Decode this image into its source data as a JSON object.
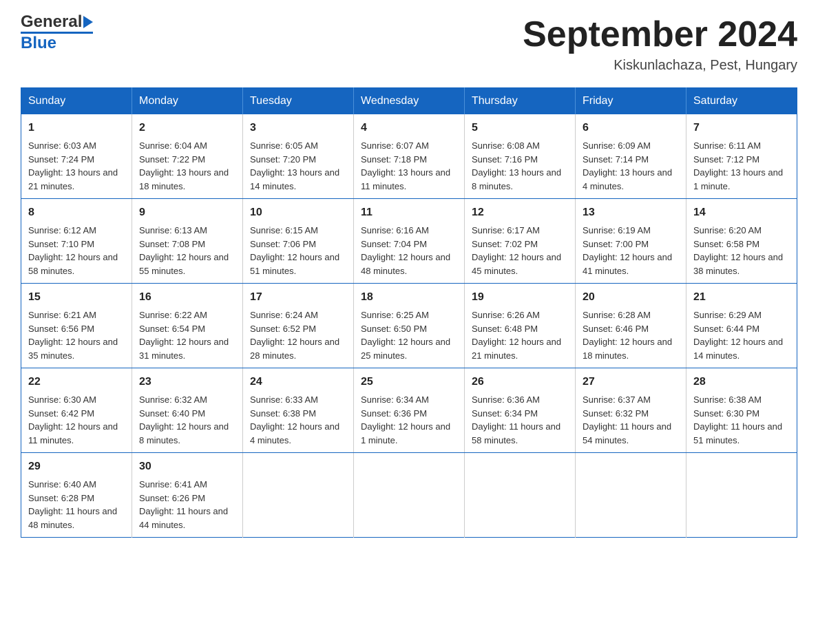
{
  "header": {
    "logo": {
      "line1": "General",
      "line2": "Blue"
    },
    "title": "September 2024",
    "location": "Kiskunlachaza, Pest, Hungary"
  },
  "weekdays": [
    "Sunday",
    "Monday",
    "Tuesday",
    "Wednesday",
    "Thursday",
    "Friday",
    "Saturday"
  ],
  "weeks": [
    [
      {
        "day": "1",
        "sunrise": "Sunrise: 6:03 AM",
        "sunset": "Sunset: 7:24 PM",
        "daylight": "Daylight: 13 hours and 21 minutes."
      },
      {
        "day": "2",
        "sunrise": "Sunrise: 6:04 AM",
        "sunset": "Sunset: 7:22 PM",
        "daylight": "Daylight: 13 hours and 18 minutes."
      },
      {
        "day": "3",
        "sunrise": "Sunrise: 6:05 AM",
        "sunset": "Sunset: 7:20 PM",
        "daylight": "Daylight: 13 hours and 14 minutes."
      },
      {
        "day": "4",
        "sunrise": "Sunrise: 6:07 AM",
        "sunset": "Sunset: 7:18 PM",
        "daylight": "Daylight: 13 hours and 11 minutes."
      },
      {
        "day": "5",
        "sunrise": "Sunrise: 6:08 AM",
        "sunset": "Sunset: 7:16 PM",
        "daylight": "Daylight: 13 hours and 8 minutes."
      },
      {
        "day": "6",
        "sunrise": "Sunrise: 6:09 AM",
        "sunset": "Sunset: 7:14 PM",
        "daylight": "Daylight: 13 hours and 4 minutes."
      },
      {
        "day": "7",
        "sunrise": "Sunrise: 6:11 AM",
        "sunset": "Sunset: 7:12 PM",
        "daylight": "Daylight: 13 hours and 1 minute."
      }
    ],
    [
      {
        "day": "8",
        "sunrise": "Sunrise: 6:12 AM",
        "sunset": "Sunset: 7:10 PM",
        "daylight": "Daylight: 12 hours and 58 minutes."
      },
      {
        "day": "9",
        "sunrise": "Sunrise: 6:13 AM",
        "sunset": "Sunset: 7:08 PM",
        "daylight": "Daylight: 12 hours and 55 minutes."
      },
      {
        "day": "10",
        "sunrise": "Sunrise: 6:15 AM",
        "sunset": "Sunset: 7:06 PM",
        "daylight": "Daylight: 12 hours and 51 minutes."
      },
      {
        "day": "11",
        "sunrise": "Sunrise: 6:16 AM",
        "sunset": "Sunset: 7:04 PM",
        "daylight": "Daylight: 12 hours and 48 minutes."
      },
      {
        "day": "12",
        "sunrise": "Sunrise: 6:17 AM",
        "sunset": "Sunset: 7:02 PM",
        "daylight": "Daylight: 12 hours and 45 minutes."
      },
      {
        "day": "13",
        "sunrise": "Sunrise: 6:19 AM",
        "sunset": "Sunset: 7:00 PM",
        "daylight": "Daylight: 12 hours and 41 minutes."
      },
      {
        "day": "14",
        "sunrise": "Sunrise: 6:20 AM",
        "sunset": "Sunset: 6:58 PM",
        "daylight": "Daylight: 12 hours and 38 minutes."
      }
    ],
    [
      {
        "day": "15",
        "sunrise": "Sunrise: 6:21 AM",
        "sunset": "Sunset: 6:56 PM",
        "daylight": "Daylight: 12 hours and 35 minutes."
      },
      {
        "day": "16",
        "sunrise": "Sunrise: 6:22 AM",
        "sunset": "Sunset: 6:54 PM",
        "daylight": "Daylight: 12 hours and 31 minutes."
      },
      {
        "day": "17",
        "sunrise": "Sunrise: 6:24 AM",
        "sunset": "Sunset: 6:52 PM",
        "daylight": "Daylight: 12 hours and 28 minutes."
      },
      {
        "day": "18",
        "sunrise": "Sunrise: 6:25 AM",
        "sunset": "Sunset: 6:50 PM",
        "daylight": "Daylight: 12 hours and 25 minutes."
      },
      {
        "day": "19",
        "sunrise": "Sunrise: 6:26 AM",
        "sunset": "Sunset: 6:48 PM",
        "daylight": "Daylight: 12 hours and 21 minutes."
      },
      {
        "day": "20",
        "sunrise": "Sunrise: 6:28 AM",
        "sunset": "Sunset: 6:46 PM",
        "daylight": "Daylight: 12 hours and 18 minutes."
      },
      {
        "day": "21",
        "sunrise": "Sunrise: 6:29 AM",
        "sunset": "Sunset: 6:44 PM",
        "daylight": "Daylight: 12 hours and 14 minutes."
      }
    ],
    [
      {
        "day": "22",
        "sunrise": "Sunrise: 6:30 AM",
        "sunset": "Sunset: 6:42 PM",
        "daylight": "Daylight: 12 hours and 11 minutes."
      },
      {
        "day": "23",
        "sunrise": "Sunrise: 6:32 AM",
        "sunset": "Sunset: 6:40 PM",
        "daylight": "Daylight: 12 hours and 8 minutes."
      },
      {
        "day": "24",
        "sunrise": "Sunrise: 6:33 AM",
        "sunset": "Sunset: 6:38 PM",
        "daylight": "Daylight: 12 hours and 4 minutes."
      },
      {
        "day": "25",
        "sunrise": "Sunrise: 6:34 AM",
        "sunset": "Sunset: 6:36 PM",
        "daylight": "Daylight: 12 hours and 1 minute."
      },
      {
        "day": "26",
        "sunrise": "Sunrise: 6:36 AM",
        "sunset": "Sunset: 6:34 PM",
        "daylight": "Daylight: 11 hours and 58 minutes."
      },
      {
        "day": "27",
        "sunrise": "Sunrise: 6:37 AM",
        "sunset": "Sunset: 6:32 PM",
        "daylight": "Daylight: 11 hours and 54 minutes."
      },
      {
        "day": "28",
        "sunrise": "Sunrise: 6:38 AM",
        "sunset": "Sunset: 6:30 PM",
        "daylight": "Daylight: 11 hours and 51 minutes."
      }
    ],
    [
      {
        "day": "29",
        "sunrise": "Sunrise: 6:40 AM",
        "sunset": "Sunset: 6:28 PM",
        "daylight": "Daylight: 11 hours and 48 minutes."
      },
      {
        "day": "30",
        "sunrise": "Sunrise: 6:41 AM",
        "sunset": "Sunset: 6:26 PM",
        "daylight": "Daylight: 11 hours and 44 minutes."
      },
      null,
      null,
      null,
      null,
      null
    ]
  ]
}
